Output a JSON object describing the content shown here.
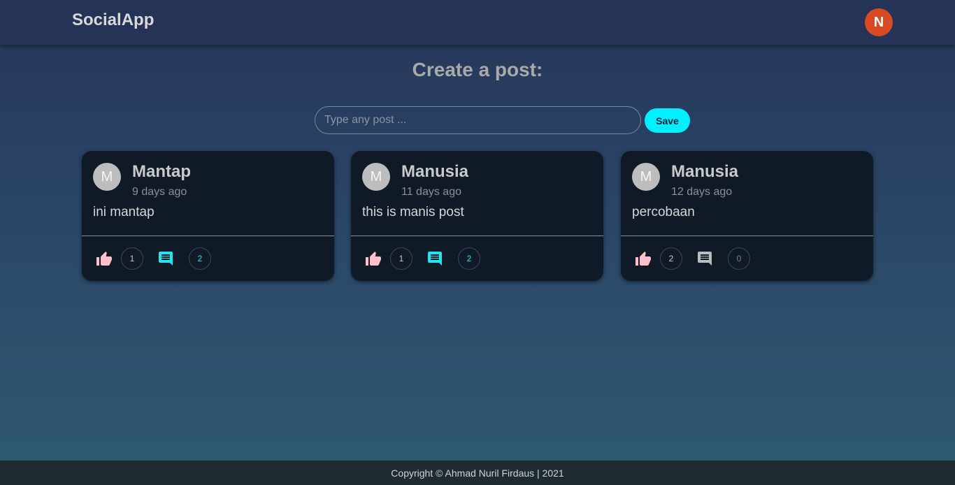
{
  "navbar": {
    "brand": "SocialApp",
    "user_initial": "N"
  },
  "create_post": {
    "title": "Create a post:",
    "placeholder": "Type any post ...",
    "value": "",
    "save_label": "Save"
  },
  "posts": [
    {
      "initial": "M",
      "author": "Mantap",
      "time": "9 days ago",
      "body": "ini mantap",
      "likes": "1",
      "comments": "2",
      "comment_icon_color": "#1ee6f0"
    },
    {
      "initial": "M",
      "author": "Manusia",
      "time": "11 days ago",
      "body": "this is manis post",
      "likes": "1",
      "comments": "2",
      "comment_icon_color": "#1ee6f0"
    },
    {
      "initial": "M",
      "author": "Manusia",
      "time": "12 days ago",
      "body": "percobaan",
      "likes": "2",
      "comments": "0",
      "comment_icon_color": "#bdbdbd"
    }
  ],
  "icons": {
    "like": "thumb-up-icon",
    "comment": "comment-icon"
  },
  "colors": {
    "like_icon": "#ffc0cb",
    "accent": "#00f0ff",
    "user_avatar": "#d84a22"
  },
  "footer": {
    "text": "Copyright © Ahmad Nuril Firdaus | 2021"
  }
}
